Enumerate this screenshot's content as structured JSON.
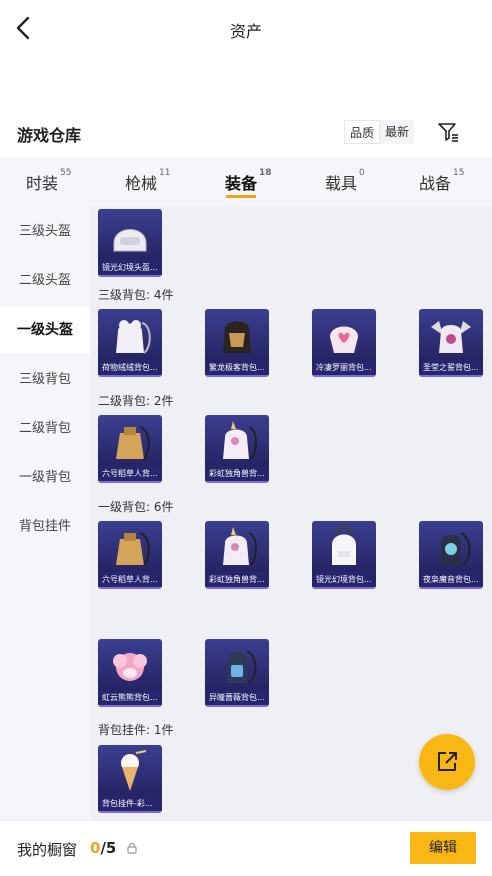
{
  "header": {
    "title": "资产",
    "back_icon": "chevron-left-icon"
  },
  "warehouse": {
    "title": "游戏仓库",
    "sort": {
      "quality": "品质",
      "latest": "最新"
    },
    "filter_icon": "filter-icon"
  },
  "tabs": [
    {
      "label": "时装",
      "count": "55"
    },
    {
      "label": "枪械",
      "count": "11"
    },
    {
      "label": "装备",
      "count": "18"
    },
    {
      "label": "载具",
      "count": "0"
    },
    {
      "label": "战备",
      "count": "15"
    }
  ],
  "active_tab": "装备",
  "sidebar": [
    {
      "label": "三级头盔"
    },
    {
      "label": "二级头盔"
    },
    {
      "label": "一级头盔"
    },
    {
      "label": "三级背包"
    },
    {
      "label": "二级背包"
    },
    {
      "label": "一级背包"
    },
    {
      "label": "背包挂件"
    }
  ],
  "active_sidebar": "一级头盔",
  "groups": [
    {
      "label": "",
      "items": [
        {
          "name": "镜光幻境头盔..."
        }
      ]
    },
    {
      "label": "三级背包: 4件",
      "items": [
        {
          "name": "荷物绒绒背包..."
        },
        {
          "name": "繁龙极客背包..."
        },
        {
          "name": "冷凄罗丽背包..."
        },
        {
          "name": "圣堂之誓背包..."
        }
      ]
    },
    {
      "label": "二级背包: 2件",
      "items": [
        {
          "name": "六号稻草人背..."
        },
        {
          "name": "彩虹独角兽背..."
        }
      ]
    },
    {
      "label": "一级背包: 6件",
      "items": [
        {
          "name": "六号稻草人背..."
        },
        {
          "name": "彩虹独角兽背..."
        },
        {
          "name": "镜光幻境背包..."
        },
        {
          "name": "夜枭魔音背包..."
        },
        {
          "name": "虹云熊熊背包..."
        },
        {
          "name": "异瞳蔷薇背包..."
        }
      ]
    },
    {
      "label": "背包挂件: 1件",
      "items": [
        {
          "name": "背包挂件-彩..."
        }
      ]
    }
  ],
  "share_icon": "share-external-icon",
  "showcase": {
    "label": "我的橱窗",
    "current": "0",
    "separator": "/",
    "max": "5",
    "lock_icon": "lock-icon",
    "edit_label": "编辑"
  },
  "colors": {
    "accent": "#f8b714",
    "underline": "#f5a11c",
    "card_bg": "#2b2a6e"
  }
}
